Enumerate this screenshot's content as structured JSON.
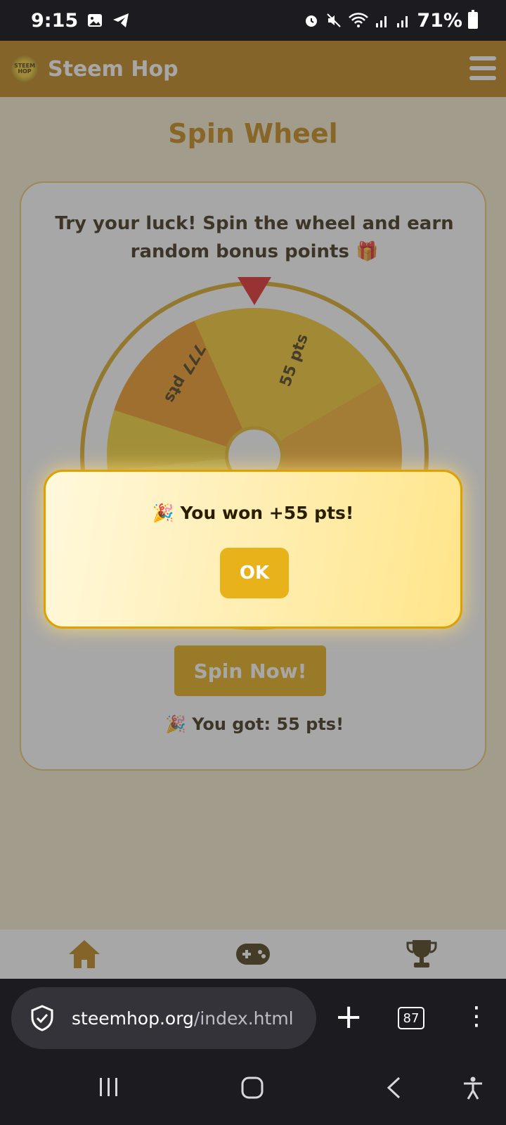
{
  "status_bar": {
    "time": "9:15",
    "battery": "71%"
  },
  "header": {
    "logo_text": "STEEM HOP",
    "title": "Steem Hop"
  },
  "page": {
    "title": "Spin Wheel",
    "description": "Try your luck! Spin the wheel and earn random bonus points 🎁",
    "spin_button": "Spin Now!",
    "result": "🎉 You got: 55 pts!"
  },
  "wheel": {
    "labels": [
      "777 pts",
      "55 pts"
    ],
    "colors": {
      "ring": "#d6a010",
      "pointer": "#e01616"
    }
  },
  "modal": {
    "message": "🎉 You won +55 pts!",
    "ok_label": "OK"
  },
  "bottom_nav": {
    "items": [
      {
        "icon": "home-icon"
      },
      {
        "icon": "gamepad-icon"
      },
      {
        "icon": "trophy-icon"
      }
    ]
  },
  "browser": {
    "url_domain": "steemhop.org",
    "url_path": "/index.html",
    "tab_count": "87"
  },
  "colors": {
    "brand": "#b87800",
    "accent": "#e8b21a"
  }
}
